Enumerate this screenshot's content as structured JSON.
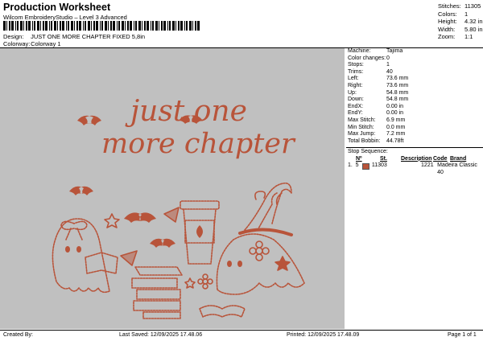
{
  "header": {
    "title": "Production Worksheet",
    "subtitle": "Wilcom EmbroideryStudio – Level 3 Advanced",
    "design_label": "Design:",
    "design_value": "JUST ONE MORE CHAPTER FIXED 5,8in",
    "colorway_label": "Colorway:",
    "colorway_value": "Colorway 1"
  },
  "stats": [
    {
      "k": "Stitches:",
      "v": "11305"
    },
    {
      "k": "Colors:",
      "v": "1"
    },
    {
      "k": "Height:",
      "v": "4.32 in"
    },
    {
      "k": "Width:",
      "v": "5.80 in"
    },
    {
      "k": "Zoom:",
      "v": "1:1"
    }
  ],
  "design": {
    "line1": "just one",
    "line2": "more chapter",
    "thread_color": "#b8543a",
    "background": "#c0c0c0"
  },
  "machine_info": [
    {
      "k": "Machine:",
      "v": "Tajima"
    },
    {
      "k": "Color changes:",
      "v": "0"
    },
    {
      "k": "Stops:",
      "v": "1"
    },
    {
      "k": "Trims:",
      "v": "40"
    },
    {
      "k": "Left:",
      "v": "73.6 mm"
    },
    {
      "k": "Right:",
      "v": "73.6 mm"
    },
    {
      "k": "Up:",
      "v": "54.8 mm"
    },
    {
      "k": "Down:",
      "v": "54.8 mm"
    },
    {
      "k": "EndX:",
      "v": "0.00 in"
    },
    {
      "k": "EndY:",
      "v": "0.00 in"
    },
    {
      "k": "Max Stitch:",
      "v": "6.9 mm"
    },
    {
      "k": "Min Stitch:",
      "v": "0.0 mm"
    },
    {
      "k": "Max Jump:",
      "v": "7.2 mm"
    },
    {
      "k": "Total Bobbin:",
      "v": "44.78ft"
    }
  ],
  "stop_sequence": {
    "label": "Stop Sequence:",
    "headers": [
      "Nº",
      "St.",
      "Description",
      "Code",
      "Brand"
    ],
    "rows": [
      {
        "idx": "1.",
        "n": "5",
        "st": "11303",
        "desc": "",
        "code": "1221",
        "brand": "Madeira Classic 40",
        "color": "#b8543a"
      }
    ]
  },
  "footer": {
    "created_by": "Created By:",
    "last_saved": "Last Saved: 12/09/2025 17.48.06",
    "printed": "Printed: 12/09/2025 17.48.09",
    "page": "Page 1 of 1"
  }
}
